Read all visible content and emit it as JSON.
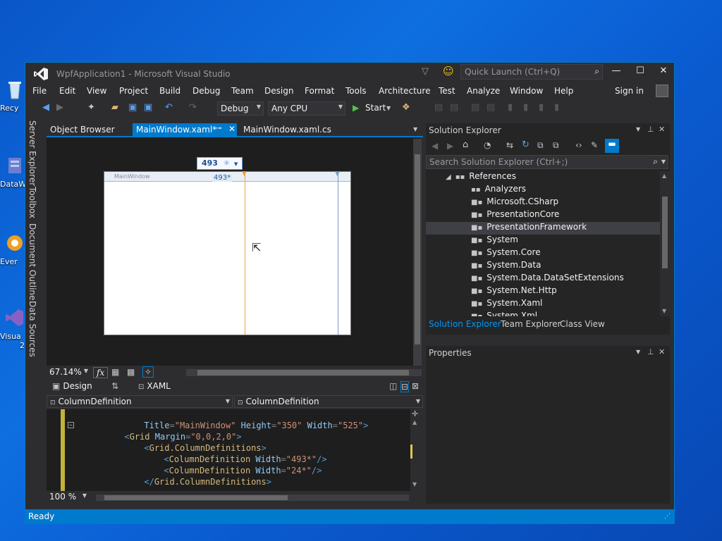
{
  "desktop": {
    "icons": [
      {
        "label": "Recy",
        "name": "recycle-bin-icon"
      },
      {
        "label": "DataW",
        "name": "datawarehouse-shortcut-icon"
      },
      {
        "label": "Ever",
        "name": "evernote-shortcut-icon"
      },
      {
        "label": "Visua",
        "name": "visual-studio-shortcut-icon"
      }
    ],
    "extra_text": "2"
  },
  "window": {
    "title": "WpfApplication1 - Microsoft Visual Studio",
    "quick_launch_placeholder": "Quick Launch (Ctrl+Q)",
    "controls": {
      "minimize": "—",
      "maximize": "☐",
      "close": "✕"
    }
  },
  "menu": {
    "items": [
      "File",
      "Edit",
      "View",
      "Project",
      "Build",
      "Debug",
      "Team",
      "Design",
      "Format",
      "Tools",
      "Architecture",
      "Test",
      "Analyze",
      "Window",
      "Help"
    ],
    "sign_in": "Sign in"
  },
  "toolbar": {
    "config": "Debug",
    "platform": "Any CPU",
    "start": "Start"
  },
  "side_tools": [
    "Server Explorer",
    "Toolbox",
    "Document Outline",
    "Data Sources"
  ],
  "doc_tabs": [
    {
      "label": "Object Browser",
      "active": false
    },
    {
      "label": "MainWindow.xaml*",
      "active": true
    },
    {
      "label": "MainWindow.xaml.cs",
      "active": false
    }
  ],
  "designer": {
    "column_badge": "493",
    "column_badge_star": "✳",
    "column_label": "493*",
    "window_caption": "MainWindow",
    "zoom": "67.14%"
  },
  "split_tabs": {
    "design": "Design",
    "xaml": "XAML"
  },
  "nav": {
    "left": "ColumnDefinition",
    "right": "ColumnDefinition"
  },
  "code": {
    "line1": {
      "attr1": "Title",
      "val1": "\"MainWindow\"",
      "attr2": "Height",
      "val2": "\"350\"",
      "attr3": "Width",
      "val3": "\"525\"",
      "end": ">"
    },
    "line2": {
      "open": "<",
      "el": "Grid",
      "attr": "Margin",
      "val": "\"0,0,2,0\"",
      "end": ">"
    },
    "line3": {
      "open": "<",
      "el": "Grid.ColumnDefinitions",
      "end": ">"
    },
    "line4": {
      "open": "<",
      "el": "ColumnDefinition",
      "attr": "Width",
      "val": "\"493*\"",
      "end": "/>"
    },
    "line5": {
      "open": "<",
      "el": "ColumnDefinition",
      "attr": "Width",
      "val": "\"24*\"",
      "end": "/>"
    },
    "line6": {
      "open": "</",
      "el": "Grid.ColumnDefinitions",
      "end": ">"
    },
    "zoom": "100 %"
  },
  "solution_explorer": {
    "title": "Solution Explorer",
    "search_placeholder": "Search Solution Explorer (Ctrl+;)",
    "tree": [
      {
        "label": "References",
        "level": 0,
        "expanded": true
      },
      {
        "label": "Analyzers",
        "level": 1
      },
      {
        "label": "Microsoft.CSharp",
        "level": 1
      },
      {
        "label": "PresentationCore",
        "level": 1
      },
      {
        "label": "PresentationFramework",
        "level": 1,
        "selected": true
      },
      {
        "label": "System",
        "level": 1
      },
      {
        "label": "System.Core",
        "level": 1
      },
      {
        "label": "System.Data",
        "level": 1
      },
      {
        "label": "System.Data.DataSetExtensions",
        "level": 1
      },
      {
        "label": "System.Net.Http",
        "level": 1
      },
      {
        "label": "System.Xaml",
        "level": 1
      },
      {
        "label": "System.Xml",
        "level": 1
      }
    ],
    "bottom_tabs": [
      "Solution Explorer",
      "Team Explorer",
      "Class View"
    ]
  },
  "properties": {
    "title": "Properties"
  },
  "status": {
    "text": "Ready"
  },
  "colors": {
    "accent": "#007acc",
    "chrome": "#2d2d30",
    "editor_bg": "#1e1e1e",
    "column_line": "#e8a33c"
  }
}
